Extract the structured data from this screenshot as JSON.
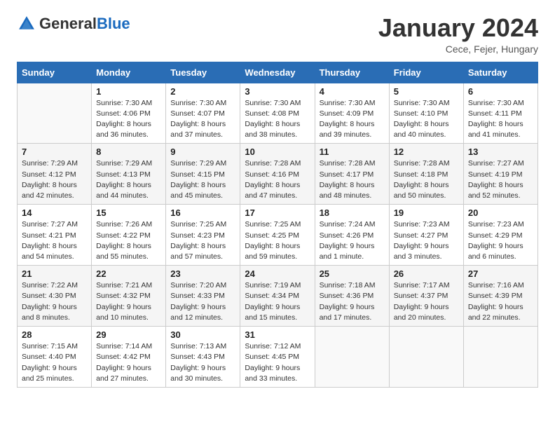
{
  "header": {
    "logo_general": "General",
    "logo_blue": "Blue",
    "title": "January 2024",
    "subtitle": "Cece, Fejer, Hungary"
  },
  "calendar": {
    "days_of_week": [
      "Sunday",
      "Monday",
      "Tuesday",
      "Wednesday",
      "Thursday",
      "Friday",
      "Saturday"
    ],
    "weeks": [
      [
        {
          "day": "",
          "info": ""
        },
        {
          "day": "1",
          "info": "Sunrise: 7:30 AM\nSunset: 4:06 PM\nDaylight: 8 hours\nand 36 minutes."
        },
        {
          "day": "2",
          "info": "Sunrise: 7:30 AM\nSunset: 4:07 PM\nDaylight: 8 hours\nand 37 minutes."
        },
        {
          "day": "3",
          "info": "Sunrise: 7:30 AM\nSunset: 4:08 PM\nDaylight: 8 hours\nand 38 minutes."
        },
        {
          "day": "4",
          "info": "Sunrise: 7:30 AM\nSunset: 4:09 PM\nDaylight: 8 hours\nand 39 minutes."
        },
        {
          "day": "5",
          "info": "Sunrise: 7:30 AM\nSunset: 4:10 PM\nDaylight: 8 hours\nand 40 minutes."
        },
        {
          "day": "6",
          "info": "Sunrise: 7:30 AM\nSunset: 4:11 PM\nDaylight: 8 hours\nand 41 minutes."
        }
      ],
      [
        {
          "day": "7",
          "info": "Sunrise: 7:29 AM\nSunset: 4:12 PM\nDaylight: 8 hours\nand 42 minutes."
        },
        {
          "day": "8",
          "info": "Sunrise: 7:29 AM\nSunset: 4:13 PM\nDaylight: 8 hours\nand 44 minutes."
        },
        {
          "day": "9",
          "info": "Sunrise: 7:29 AM\nSunset: 4:15 PM\nDaylight: 8 hours\nand 45 minutes."
        },
        {
          "day": "10",
          "info": "Sunrise: 7:28 AM\nSunset: 4:16 PM\nDaylight: 8 hours\nand 47 minutes."
        },
        {
          "day": "11",
          "info": "Sunrise: 7:28 AM\nSunset: 4:17 PM\nDaylight: 8 hours\nand 48 minutes."
        },
        {
          "day": "12",
          "info": "Sunrise: 7:28 AM\nSunset: 4:18 PM\nDaylight: 8 hours\nand 50 minutes."
        },
        {
          "day": "13",
          "info": "Sunrise: 7:27 AM\nSunset: 4:19 PM\nDaylight: 8 hours\nand 52 minutes."
        }
      ],
      [
        {
          "day": "14",
          "info": "Sunrise: 7:27 AM\nSunset: 4:21 PM\nDaylight: 8 hours\nand 54 minutes."
        },
        {
          "day": "15",
          "info": "Sunrise: 7:26 AM\nSunset: 4:22 PM\nDaylight: 8 hours\nand 55 minutes."
        },
        {
          "day": "16",
          "info": "Sunrise: 7:25 AM\nSunset: 4:23 PM\nDaylight: 8 hours\nand 57 minutes."
        },
        {
          "day": "17",
          "info": "Sunrise: 7:25 AM\nSunset: 4:25 PM\nDaylight: 8 hours\nand 59 minutes."
        },
        {
          "day": "18",
          "info": "Sunrise: 7:24 AM\nSunset: 4:26 PM\nDaylight: 9 hours\nand 1 minute."
        },
        {
          "day": "19",
          "info": "Sunrise: 7:23 AM\nSunset: 4:27 PM\nDaylight: 9 hours\nand 3 minutes."
        },
        {
          "day": "20",
          "info": "Sunrise: 7:23 AM\nSunset: 4:29 PM\nDaylight: 9 hours\nand 6 minutes."
        }
      ],
      [
        {
          "day": "21",
          "info": "Sunrise: 7:22 AM\nSunset: 4:30 PM\nDaylight: 9 hours\nand 8 minutes."
        },
        {
          "day": "22",
          "info": "Sunrise: 7:21 AM\nSunset: 4:32 PM\nDaylight: 9 hours\nand 10 minutes."
        },
        {
          "day": "23",
          "info": "Sunrise: 7:20 AM\nSunset: 4:33 PM\nDaylight: 9 hours\nand 12 minutes."
        },
        {
          "day": "24",
          "info": "Sunrise: 7:19 AM\nSunset: 4:34 PM\nDaylight: 9 hours\nand 15 minutes."
        },
        {
          "day": "25",
          "info": "Sunrise: 7:18 AM\nSunset: 4:36 PM\nDaylight: 9 hours\nand 17 minutes."
        },
        {
          "day": "26",
          "info": "Sunrise: 7:17 AM\nSunset: 4:37 PM\nDaylight: 9 hours\nand 20 minutes."
        },
        {
          "day": "27",
          "info": "Sunrise: 7:16 AM\nSunset: 4:39 PM\nDaylight: 9 hours\nand 22 minutes."
        }
      ],
      [
        {
          "day": "28",
          "info": "Sunrise: 7:15 AM\nSunset: 4:40 PM\nDaylight: 9 hours\nand 25 minutes."
        },
        {
          "day": "29",
          "info": "Sunrise: 7:14 AM\nSunset: 4:42 PM\nDaylight: 9 hours\nand 27 minutes."
        },
        {
          "day": "30",
          "info": "Sunrise: 7:13 AM\nSunset: 4:43 PM\nDaylight: 9 hours\nand 30 minutes."
        },
        {
          "day": "31",
          "info": "Sunrise: 7:12 AM\nSunset: 4:45 PM\nDaylight: 9 hours\nand 33 minutes."
        },
        {
          "day": "",
          "info": ""
        },
        {
          "day": "",
          "info": ""
        },
        {
          "day": "",
          "info": ""
        }
      ]
    ]
  }
}
